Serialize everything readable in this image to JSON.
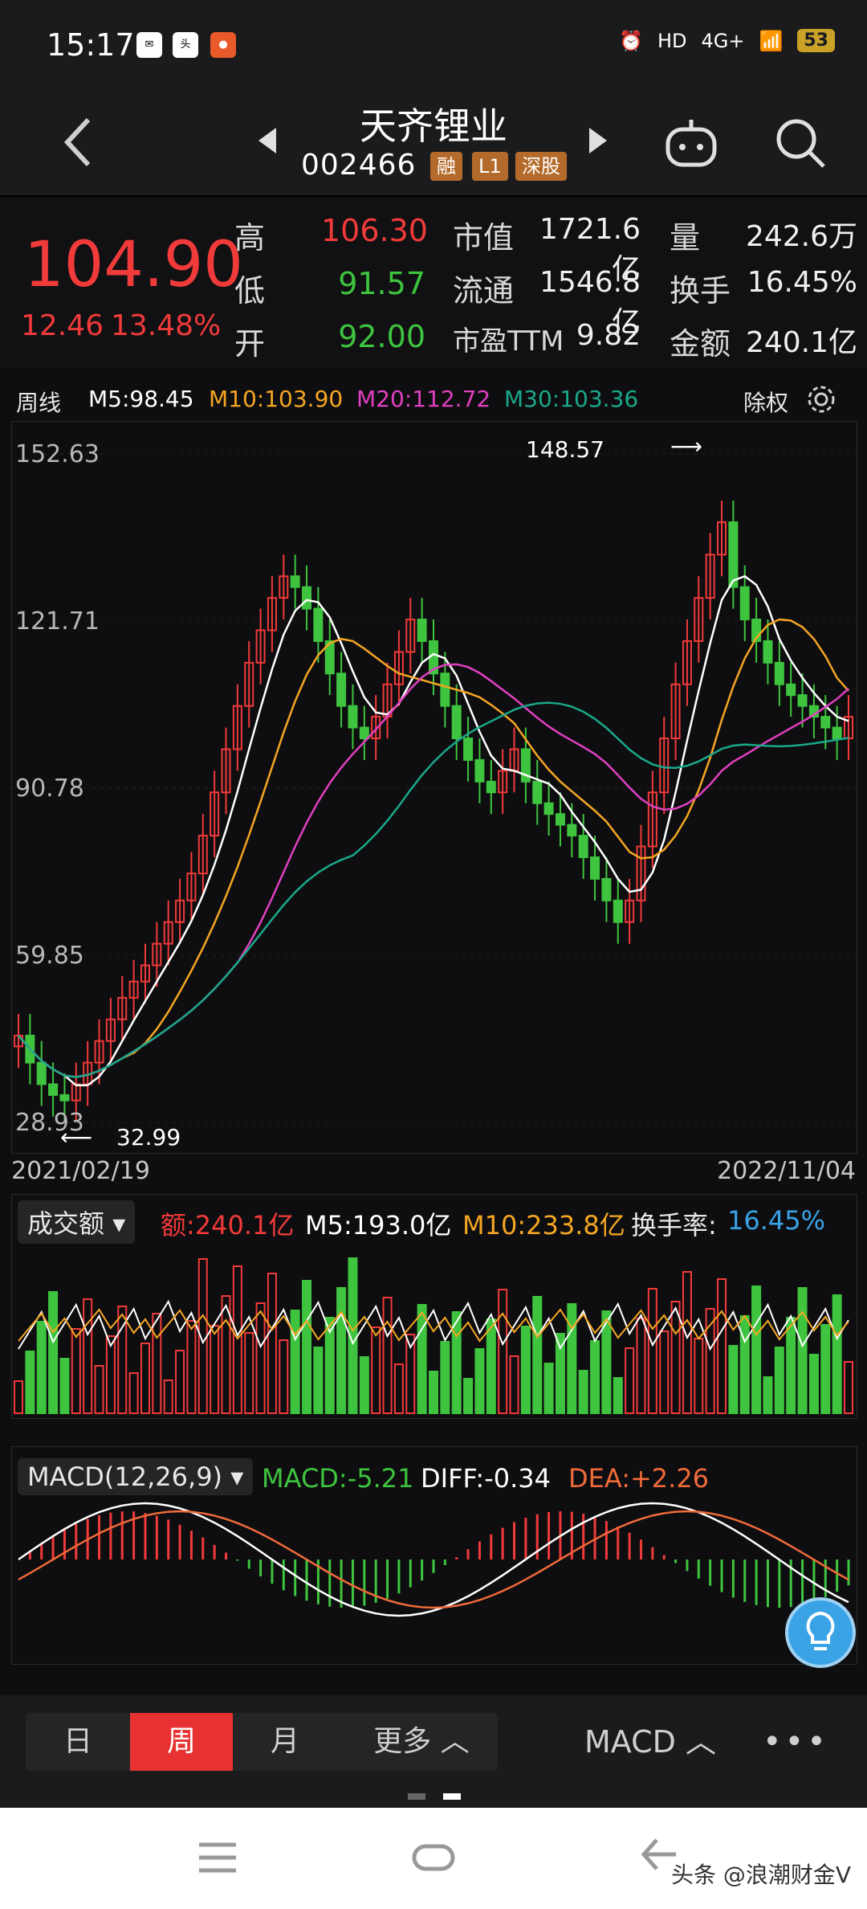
{
  "status_bar": {
    "time": "15:17",
    "network": "4G+",
    "battery": "53"
  },
  "header": {
    "title": "天齐锂业",
    "code": "002466",
    "tags": [
      "融",
      "L1",
      "深股"
    ]
  },
  "quote": {
    "price": "104.90",
    "change": "12.46",
    "change_pct": "13.48%",
    "high_label": "高",
    "high": "106.30",
    "low_label": "低",
    "low": "91.57",
    "open_label": "开",
    "open": "92.00",
    "mktcap_label": "市值",
    "mktcap": "1721.6亿",
    "float_label": "流通",
    "float": "1546.8亿",
    "pe_label": "市盈TTM",
    "pe": "9.82",
    "vol_label": "量",
    "vol": "242.6万",
    "turnover_label": "换手",
    "turnover": "16.45%",
    "amount_label": "金额",
    "amount": "240.1亿"
  },
  "ma_bar": {
    "period": "周线",
    "m5": "M5:98.45",
    "m10": "M10:103.90",
    "m20": "M20:112.72",
    "m30": "M30:103.36",
    "adjust": "除权"
  },
  "chart": {
    "y_labels": [
      "152.63",
      "121.71",
      "90.78",
      "59.85",
      "28.93"
    ],
    "high_note": "148.57",
    "low_note": "32.99",
    "start_date": "2021/02/19",
    "end_date": "2022/11/04"
  },
  "volume": {
    "selector": "成交额",
    "amount": "额:240.1亿",
    "m5": "M5:193.0亿",
    "m10": "M10:233.8亿",
    "turnover_label": "换手率:",
    "turnover": "16.45%"
  },
  "macd": {
    "selector": "MACD(12,26,9)",
    "macd": "MACD:-5.21",
    "diff": "DIFF:-0.34",
    "dea": "DEA:+2.26"
  },
  "period_tabs": [
    "日",
    "周",
    "月",
    "更多"
  ],
  "indicator_button": "MACD",
  "watermark": "头条 @浪潮财金V",
  "colors": {
    "up": "#f13a3a",
    "down": "#3ec43e",
    "ma5": "#ffffff",
    "ma10": "#f5a623",
    "ma20": "#e040c0",
    "ma30": "#1aa88a"
  }
}
